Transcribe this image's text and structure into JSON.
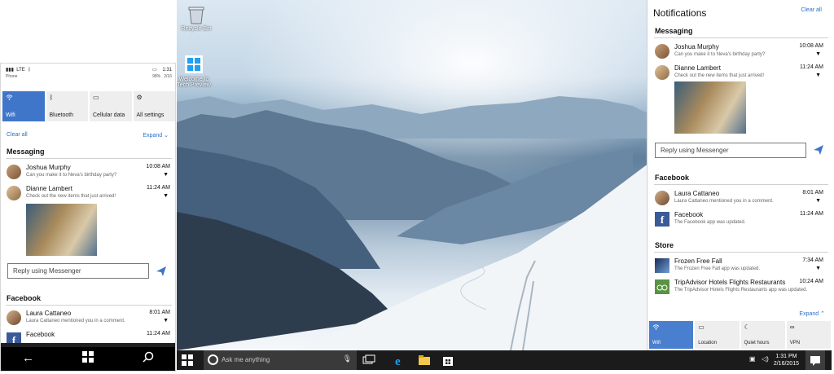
{
  "phone": {
    "status": {
      "signal": "LTE",
      "carrier": "Phone",
      "time": "1:31",
      "battery": "98%",
      "date": "2/16"
    },
    "tiles": [
      {
        "label": "Wifi",
        "icon": "wifi-icon",
        "on": true
      },
      {
        "label": "Bluetooth",
        "icon": "bluetooth-icon",
        "on": false
      },
      {
        "label": "Cellular data",
        "icon": "cellular-icon",
        "on": false
      },
      {
        "label": "All settings",
        "icon": "gear-icon",
        "on": false
      }
    ],
    "clear_all": "Clear all",
    "expand": "Expand",
    "messaging": {
      "title": "Messaging",
      "items": [
        {
          "name": "Joshua Murphy",
          "message": "Can you make it to Neva's birthday party?",
          "time": "10:08 AM"
        },
        {
          "name": "Dianne Lambert",
          "message": "Check out the new items that just arrived!",
          "time": "11:24 AM"
        }
      ],
      "reply_placeholder": "Reply using Messenger"
    },
    "facebook": {
      "title": "Facebook",
      "items": [
        {
          "name": "Laura Cattaneo",
          "message": "Laura Cattaneo mentioned you in a comment.",
          "time": "8:01 AM"
        },
        {
          "name": "Facebook",
          "message": "",
          "time": "11:24 AM"
        }
      ]
    },
    "nav": {
      "back": "←",
      "windows": "windows-logo-icon",
      "search": "search-icon"
    }
  },
  "desktop": {
    "icons": [
      {
        "label": "Recycle Bin",
        "icon": "recycle-bin-icon"
      },
      {
        "label": "Welcome to Tech Preview",
        "icon": "windows-logo-icon"
      }
    ]
  },
  "action_center": {
    "title": "Notifications",
    "clear_all": "Clear all",
    "messaging": {
      "title": "Messaging",
      "items": [
        {
          "name": "Joshua Murphy",
          "message": "Can you make it to Neva's birthday party?",
          "time": "10:08 AM"
        },
        {
          "name": "Dianne Lambert",
          "message": "Check out the new items that just arrived!",
          "time": "11:24 AM"
        }
      ],
      "reply_placeholder": "Reply using Messenger"
    },
    "facebook": {
      "title": "Facebook",
      "items": [
        {
          "name": "Laura Cattaneo",
          "message": "Laura Cattaneo mentioned you in a comment.",
          "time": "8:01 AM"
        },
        {
          "name": "Facebook",
          "message": "The Facebook app was updated.",
          "time": "11:24 AM"
        }
      ]
    },
    "store": {
      "title": "Store",
      "items": [
        {
          "name": "Frozen Free Fall",
          "message": "The Frozen Free Fall app was updated.",
          "time": "7:34 AM"
        },
        {
          "name": "TripAdvisor Hotels Flights Restaurants",
          "message": "The TripAdvisor Hotels Flights Restaurants app was updated.",
          "time": "10:24 AM"
        }
      ]
    },
    "expand": "Expand",
    "tiles": [
      {
        "label": "Wifi",
        "icon": "wifi-icon",
        "on": true
      },
      {
        "label": "Location",
        "icon": "location-icon",
        "on": false
      },
      {
        "label": "Quiet hours",
        "icon": "moon-icon",
        "on": false
      },
      {
        "label": "VPN",
        "icon": "vpn-icon",
        "on": false
      }
    ]
  },
  "taskbar": {
    "search_placeholder": "Ask me anything",
    "time": "1:31 PM",
    "date": "2/16/2015"
  },
  "colors": {
    "accent": "#3f76c9",
    "link": "#2a6fc9",
    "taskbar": "#1b1b1b",
    "facebook": "#3b5a98"
  }
}
